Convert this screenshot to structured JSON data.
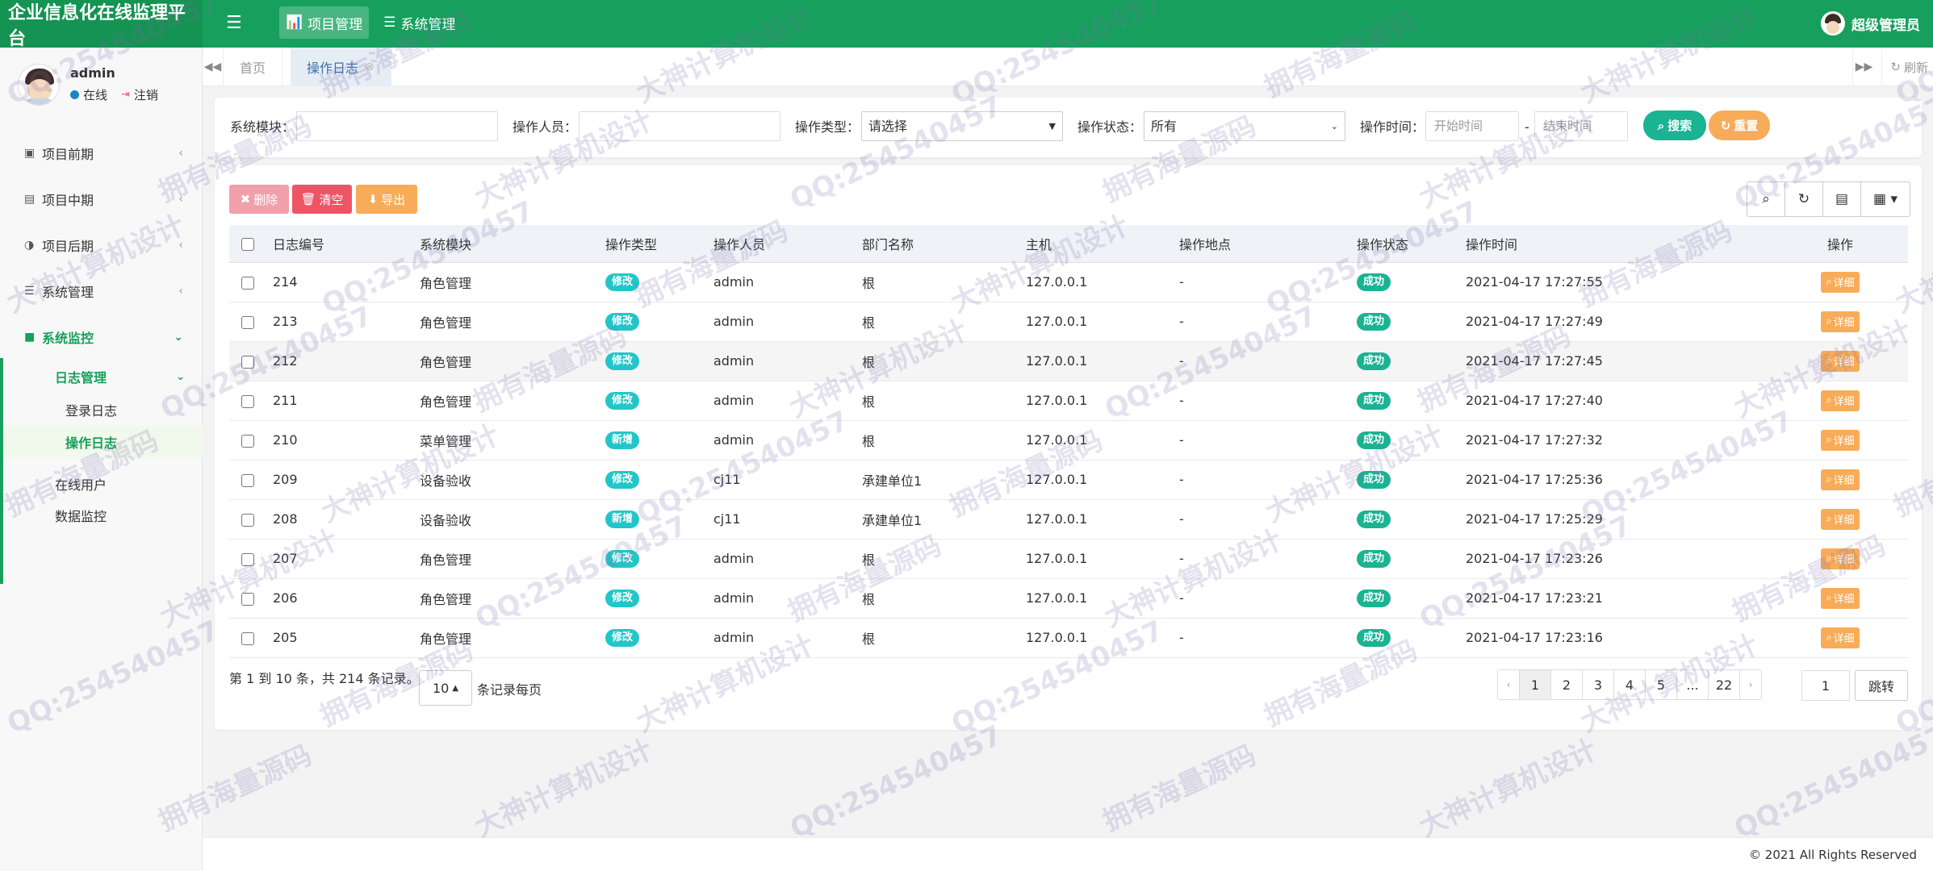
{
  "app": {
    "brand": "企业信息化在线监理平台",
    "top_nav": [
      {
        "icon": "bar-chart-icon",
        "label": "项目管理",
        "active": true
      },
      {
        "icon": "list-icon",
        "label": "系统管理",
        "active": false
      }
    ],
    "top_user": "超级管理员"
  },
  "sidebar": {
    "user": {
      "name": "admin",
      "status": "在线",
      "logout": "注销"
    },
    "menu": [
      {
        "icon": "id-card-icon",
        "label": "项目前期"
      },
      {
        "icon": "clipboard-icon",
        "label": "项目中期"
      },
      {
        "icon": "half-circle-icon",
        "label": "项目后期"
      },
      {
        "icon": "list-icon",
        "label": "系统管理"
      },
      {
        "icon": "video-camera-icon",
        "label": "系统监控"
      }
    ],
    "submenu": {
      "log_mgmt": "日志管理",
      "login_log": "登录日志",
      "op_log": "操作日志",
      "online_users": "在线用户",
      "data_monitor": "数据监控"
    }
  },
  "tabs": {
    "items": [
      {
        "label": "首页",
        "active": false
      },
      {
        "label": "操作日志",
        "active": true
      }
    ],
    "refresh": "刷新"
  },
  "search": {
    "module_label": "系统模块：",
    "operator_label": "操作人员：",
    "type_label": "操作类型：",
    "type_value": "请选择",
    "status_label": "操作状态：",
    "status_value": "所有",
    "time_label": "操作时间：",
    "start_placeholder": "开始时间",
    "dash": "-",
    "end_placeholder": "结束时间",
    "search_btn": "搜索",
    "reset_btn": "重置"
  },
  "toolbar": {
    "delete": "删除",
    "clear": "清空",
    "export": "导出"
  },
  "table": {
    "columns": [
      "日志编号",
      "系统模块",
      "操作类型",
      "操作人员",
      "部门名称",
      "主机",
      "操作地点",
      "操作状态",
      "操作时间",
      "操作"
    ],
    "detail_label": "详细",
    "rows": [
      {
        "id": "214",
        "module": "角色管理",
        "type": "修改",
        "user": "admin",
        "dept": "根",
        "host": "127.0.0.1",
        "loc": "-",
        "status": "成功",
        "time": "2021-04-17 17:27:55"
      },
      {
        "id": "213",
        "module": "角色管理",
        "type": "修改",
        "user": "admin",
        "dept": "根",
        "host": "127.0.0.1",
        "loc": "-",
        "status": "成功",
        "time": "2021-04-17 17:27:49"
      },
      {
        "id": "212",
        "module": "角色管理",
        "type": "修改",
        "user": "admin",
        "dept": "根",
        "host": "127.0.0.1",
        "loc": "-",
        "status": "成功",
        "time": "2021-04-17 17:27:45"
      },
      {
        "id": "211",
        "module": "角色管理",
        "type": "修改",
        "user": "admin",
        "dept": "根",
        "host": "127.0.0.1",
        "loc": "-",
        "status": "成功",
        "time": "2021-04-17 17:27:40"
      },
      {
        "id": "210",
        "module": "菜单管理",
        "type": "新增",
        "user": "admin",
        "dept": "根",
        "host": "127.0.0.1",
        "loc": "-",
        "status": "成功",
        "time": "2021-04-17 17:27:32"
      },
      {
        "id": "209",
        "module": "设备验收",
        "type": "修改",
        "user": "cj11",
        "dept": "承建单位1",
        "host": "127.0.0.1",
        "loc": "-",
        "status": "成功",
        "time": "2021-04-17 17:25:36"
      },
      {
        "id": "208",
        "module": "设备验收",
        "type": "新增",
        "user": "cj11",
        "dept": "承建单位1",
        "host": "127.0.0.1",
        "loc": "-",
        "status": "成功",
        "time": "2021-04-17 17:25:29"
      },
      {
        "id": "207",
        "module": "角色管理",
        "type": "修改",
        "user": "admin",
        "dept": "根",
        "host": "127.0.0.1",
        "loc": "-",
        "status": "成功",
        "time": "2021-04-17 17:23:26"
      },
      {
        "id": "206",
        "module": "角色管理",
        "type": "修改",
        "user": "admin",
        "dept": "根",
        "host": "127.0.0.1",
        "loc": "-",
        "status": "成功",
        "time": "2021-04-17 17:23:21"
      },
      {
        "id": "205",
        "module": "角色管理",
        "type": "修改",
        "user": "admin",
        "dept": "根",
        "host": "127.0.0.1",
        "loc": "-",
        "status": "成功",
        "time": "2021-04-17 17:23:16"
      }
    ]
  },
  "pagination": {
    "info": "第 1 到 10 条，共 214 条记录。",
    "page_size": "10",
    "suffix": "条记录每页",
    "prev": "‹",
    "pages": [
      "1",
      "2",
      "3",
      "4",
      "5",
      "...",
      "22"
    ],
    "next": "›",
    "jump_value": "1",
    "jump_btn": "跳转"
  },
  "footer": "© 2021 All Rights Reserved",
  "watermark": [
    "QQ:254540457",
    "拥有海量源码",
    "大神计算机设计"
  ],
  "colors": {
    "brand_green": "#17a05d",
    "danger": "#ed5565",
    "warning": "#f8ac59",
    "info": "#23c6c8",
    "success": "#1ab394"
  }
}
